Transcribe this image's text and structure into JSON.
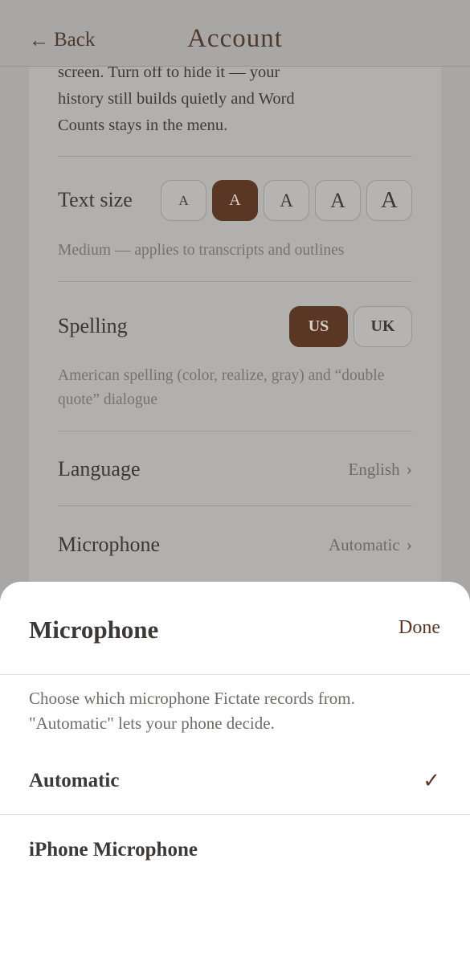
{
  "header": {
    "back_arrow": "←",
    "back_label": "Back",
    "title": "Account"
  },
  "background": {
    "note": "screen. Turn off to hide it — your history still builds quietly and Word Counts stays in the menu.",
    "text_size": {
      "label": "Text size",
      "options": [
        "A",
        "A",
        "A",
        "A",
        "A"
      ],
      "selected_index": 1,
      "caption": "Medium — applies to transcripts and outlines"
    },
    "spelling": {
      "label": "Spelling",
      "options": [
        "US",
        "UK"
      ],
      "selected": "US",
      "caption": "American spelling (color, realize, gray) and “double quote” dialogue"
    },
    "language": {
      "label": "Language",
      "value": "English"
    },
    "microphone": {
      "label": "Microphone",
      "value": "Automatic"
    }
  },
  "sheet": {
    "title": "Microphone",
    "done_label": "Done",
    "description": "Choose which microphone Fictate records from. \"Automatic\" lets your phone decide.",
    "options": [
      {
        "label": "Automatic",
        "selected": true
      },
      {
        "label": "iPhone Microphone",
        "selected": false
      }
    ],
    "check_glyph": "✓"
  },
  "colors": {
    "accent": "#5a3624",
    "overlay": "#a9a7a5",
    "sheet_bg": "#ffffff",
    "text_dark": "#3b3835"
  }
}
